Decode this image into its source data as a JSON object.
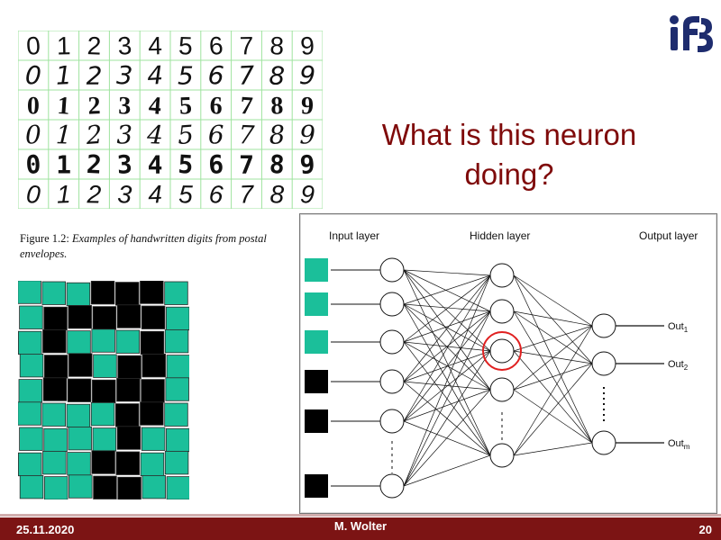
{
  "slide": {
    "title": "What is this neuron doing?",
    "figure_caption": {
      "lead": "Figure 1.2:",
      "rest": "Examples of handwritten digits from postal envelopes."
    },
    "digits_table": {
      "columns": [
        "0",
        "1",
        "2",
        "3",
        "4",
        "5",
        "6",
        "7",
        "8",
        "9"
      ],
      "rows": 6
    },
    "network": {
      "input_label": "Input layer",
      "hidden_label": "Hidden layer",
      "output_label": "Output layer",
      "outputs": [
        "Out1",
        "Out2",
        "Outm"
      ],
      "input_square_colors": [
        "#1bbf9a",
        "#1bbf9a",
        "#1bbf9a",
        "#000000",
        "#000000",
        "#000000"
      ]
    },
    "pixel_grid": {
      "cols": 7,
      "rows": 9,
      "on_color": "#000000",
      "off_color": "#1bbf9a",
      "cells": [
        [
          0,
          0,
          0,
          1,
          1,
          1,
          0
        ],
        [
          0,
          1,
          1,
          1,
          1,
          1,
          0
        ],
        [
          0,
          1,
          0,
          0,
          0,
          1,
          0
        ],
        [
          0,
          1,
          1,
          0,
          1,
          1,
          0
        ],
        [
          0,
          1,
          1,
          1,
          1,
          1,
          0
        ],
        [
          0,
          0,
          0,
          0,
          1,
          1,
          0
        ],
        [
          0,
          0,
          0,
          0,
          1,
          0,
          0
        ],
        [
          0,
          0,
          0,
          1,
          1,
          0,
          0
        ],
        [
          0,
          0,
          0,
          1,
          1,
          0,
          0
        ]
      ]
    }
  },
  "footer": {
    "date": "25.11.2020",
    "author": "M. Wolter",
    "page": "20"
  },
  "colors": {
    "accent": "#7c1414",
    "title": "#7f0a0a",
    "teal": "#1bbf9a",
    "highlight": "#e02020",
    "logo": "#1e2c6e"
  }
}
